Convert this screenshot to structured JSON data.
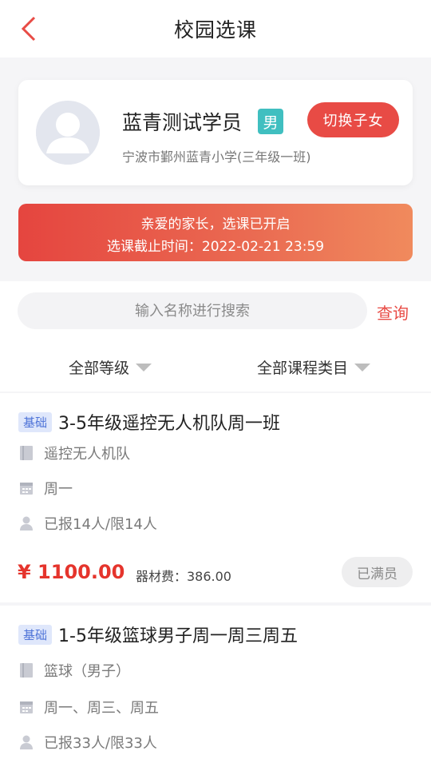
{
  "header": {
    "title": "校园选课",
    "back_icon": "chevron-left-icon"
  },
  "profile": {
    "name": "蓝青测试学员",
    "gender": "男",
    "school": "宁波市鄞州蓝青小学(三年级一班)",
    "switch_label": "切换子女"
  },
  "notice": {
    "line1": "亲爱的家长，选课已开启",
    "line2": "选课截止时间：2022-02-21 23:59"
  },
  "search": {
    "placeholder": "输入名称进行搜索",
    "query_label": "查询"
  },
  "filters": {
    "level": "全部等级",
    "category": "全部课程类目"
  },
  "courses": [
    {
      "level": "基础",
      "title": "3-5年级遥控无人机队周一班",
      "category": "遥控无人机队",
      "days": "周一",
      "enrollment": "已报14人/限14人",
      "price": "¥ 1100.00",
      "fee": "器材费：386.00",
      "status": "已满员"
    },
    {
      "level": "基础",
      "title": "1-5年级篮球男子周一周三周五",
      "category": "篮球（男子）",
      "days": "周一、周三、周五",
      "enrollment": "已报33人/限33人"
    }
  ],
  "colors": {
    "accent": "#e84b45",
    "badge_teal": "#40bfc0",
    "level_blue": "#4f74d8"
  }
}
